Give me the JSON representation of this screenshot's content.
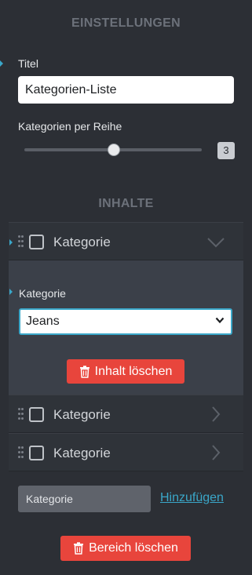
{
  "settings": {
    "title": "EINSTELLUNGEN",
    "title_label": "Titel",
    "title_value": "Kategorien-Liste",
    "per_row_label": "Kategorien per Reihe",
    "per_row_value": "3",
    "slider_fraction": 0.5
  },
  "contents": {
    "title": "INHALTE",
    "items": [
      {
        "label": "Kategorie",
        "expanded": true
      },
      {
        "label": "Kategorie",
        "expanded": false
      },
      {
        "label": "Kategorie",
        "expanded": false
      }
    ],
    "expanded_field_label": "Kategorie",
    "expanded_select_value": "Jeans",
    "delete_item_label": "Inhalt löschen"
  },
  "add": {
    "input_value": "Kategorie",
    "link_label": "Hinzufügen"
  },
  "delete_section_label": "Bereich löschen",
  "icons": {
    "drag": "drag-handle-icon",
    "checkbox": "checkbox-icon",
    "chevron_down": "chevron-down-icon",
    "chevron_right": "chevron-right-icon",
    "trash": "trash-icon"
  },
  "colors": {
    "background": "#2c2f35",
    "accent": "#3aa7c9",
    "danger": "#e8453c"
  }
}
